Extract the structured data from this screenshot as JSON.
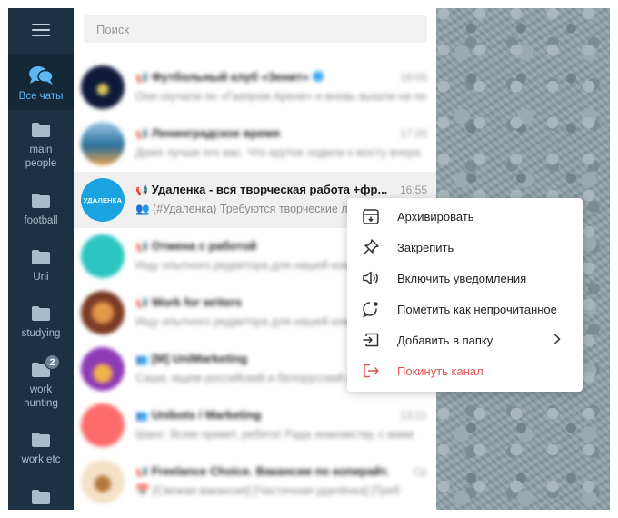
{
  "folders": [
    {
      "label": "Все чаты",
      "active": true
    },
    {
      "label": "main people"
    },
    {
      "label": "football"
    },
    {
      "label": "Uni"
    },
    {
      "label": "studying"
    },
    {
      "label": "work hunting",
      "badge": "2"
    },
    {
      "label": "work etc"
    },
    {
      "label": ""
    }
  ],
  "search": {
    "placeholder": "Поиск"
  },
  "chats": [
    {
      "title": "Футбольный клуб «Зенит»",
      "time": "18:05",
      "preview": "Они скучали по «Газпром Арене» и вновь вышли на поле",
      "avatar": "#0f1a3a"
    },
    {
      "title": "Ленинградское время",
      "time": "17:20",
      "preview": "Даже лучше его вас. Что крутое ходили к мосту вчера",
      "avatar": "#2a6f9b"
    },
    {
      "title": "Удаленка - вся творческая работа +фр...",
      "time": "16:55",
      "preview": "👥 (#Удаленка) Требуются творческие люди",
      "avatar": "#19a3e0",
      "selected": true
    },
    {
      "title": "Отмена с работой",
      "time": "",
      "preview": "Ищу опытного редактора для нашей команды",
      "avatar": "#2bc6c2"
    },
    {
      "title": "Work for writers",
      "time": "",
      "preview": "Ищу опытного редактора для нашей команды",
      "avatar": "#7a3a24"
    },
    {
      "title": "[M] UniMarketing",
      "time": "",
      "preview": "Саша: ищем российский и белорусский маркет",
      "avatar": "#8e3ab6"
    },
    {
      "title": "Unibots / Marketing",
      "time": "13:21",
      "preview": "Шанс: Всем привет, ребята! Рада знакомству, с вами",
      "avatar": "#ff6b6b"
    },
    {
      "title": "Freelance Choice. Вакансии по копирайт...",
      "time": "Ср",
      "preview": "📅 [Свежая вакансия] [Частичная удалёнка] [Треб",
      "avatar": "#f4e1c8"
    }
  ],
  "selected_avatar_text": "УДАЛЕНКА",
  "context_menu": [
    {
      "label": "Архивировать",
      "icon": "archive-icon"
    },
    {
      "label": "Закрепить",
      "icon": "pin-icon"
    },
    {
      "label": "Включить уведомления",
      "icon": "speaker-icon"
    },
    {
      "label": "Пометить как непрочитанное",
      "icon": "unread-bubble-icon"
    },
    {
      "label": "Добавить в папку",
      "icon": "add-to-folder-icon",
      "submenu": true
    },
    {
      "label": "Покинуть канал",
      "icon": "leave-icon",
      "danger": true
    }
  ],
  "colors": {
    "sidebar": "#1c3244",
    "accent": "#5db7f3",
    "danger": "#e05252"
  }
}
